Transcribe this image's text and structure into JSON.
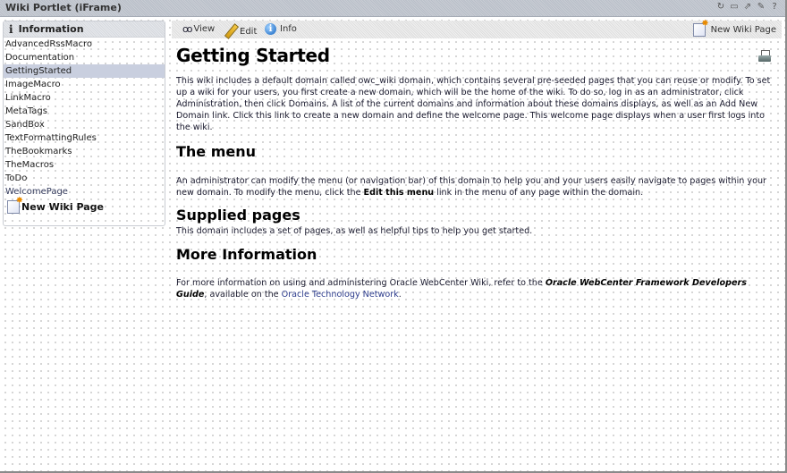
{
  "window": {
    "title": "Wiki Portlet (iFrame)",
    "title_icons": [
      "refresh-icon",
      "minimize-icon",
      "maximize-icon",
      "customize-icon",
      "help-icon"
    ]
  },
  "sidebar": {
    "header": "Information",
    "items": [
      {
        "label": "AdvancedRssMacro",
        "selected": false
      },
      {
        "label": "Documentation",
        "selected": false
      },
      {
        "label": "GettingStarted",
        "selected": true
      },
      {
        "label": "ImageMacro",
        "selected": false
      },
      {
        "label": "LinkMacro",
        "selected": false
      },
      {
        "label": "MetaTags",
        "selected": false
      },
      {
        "label": "SandBox",
        "selected": false
      },
      {
        "label": "TextFormattingRules",
        "selected": false
      },
      {
        "label": "TheBookmarks",
        "selected": false
      },
      {
        "label": "TheMacros",
        "selected": false
      },
      {
        "label": "ToDo",
        "selected": false
      },
      {
        "label": "WelcomePage",
        "selected": false
      }
    ],
    "new_page_label": "New Wiki Page"
  },
  "toolbar": {
    "view": "View",
    "edit": "Edit",
    "info": "Info",
    "new_page": "New Wiki Page"
  },
  "page": {
    "title": "Getting Started",
    "intro": "This wiki includes a default domain called owc_wiki domain, which contains several pre-seeded pages that you can reuse or modify. To set up a wiki for your users, you first create a new domain, which will be the home of the wiki. To do so, log in as an administrator, click Administration, then click Domains. A list of the current domains and information about these domains displays, as well as an Add New Domain link. Click this link to create a new domain and define the welcome page. This welcome page displays when a user first logs into the wiki.",
    "menu_heading": "The menu",
    "menu_text_1": "An administrator can modify the menu (or navigation bar) of this domain to help you and your users easily navigate to pages within your new domain. To modify the menu, click the ",
    "menu_text_bold": "Edit this menu",
    "menu_text_2": " link in the menu of any page within the domain.",
    "supplied_heading": "Supplied pages",
    "supplied_text": "This domain includes a set of pages, as well as helpful tips to help you get started.",
    "more_heading": "More Information",
    "more_text_1": "For more information on using and administering Oracle WebCenter Wiki, refer to the ",
    "more_guide": "Oracle WebCenter Framework Developers Guide",
    "more_text_2": ", available on the ",
    "more_link": "Oracle Technology Network",
    "more_text_3": "."
  },
  "colors": {
    "selected_bg": "#c9cfdf",
    "link": "#2d3c8c"
  }
}
